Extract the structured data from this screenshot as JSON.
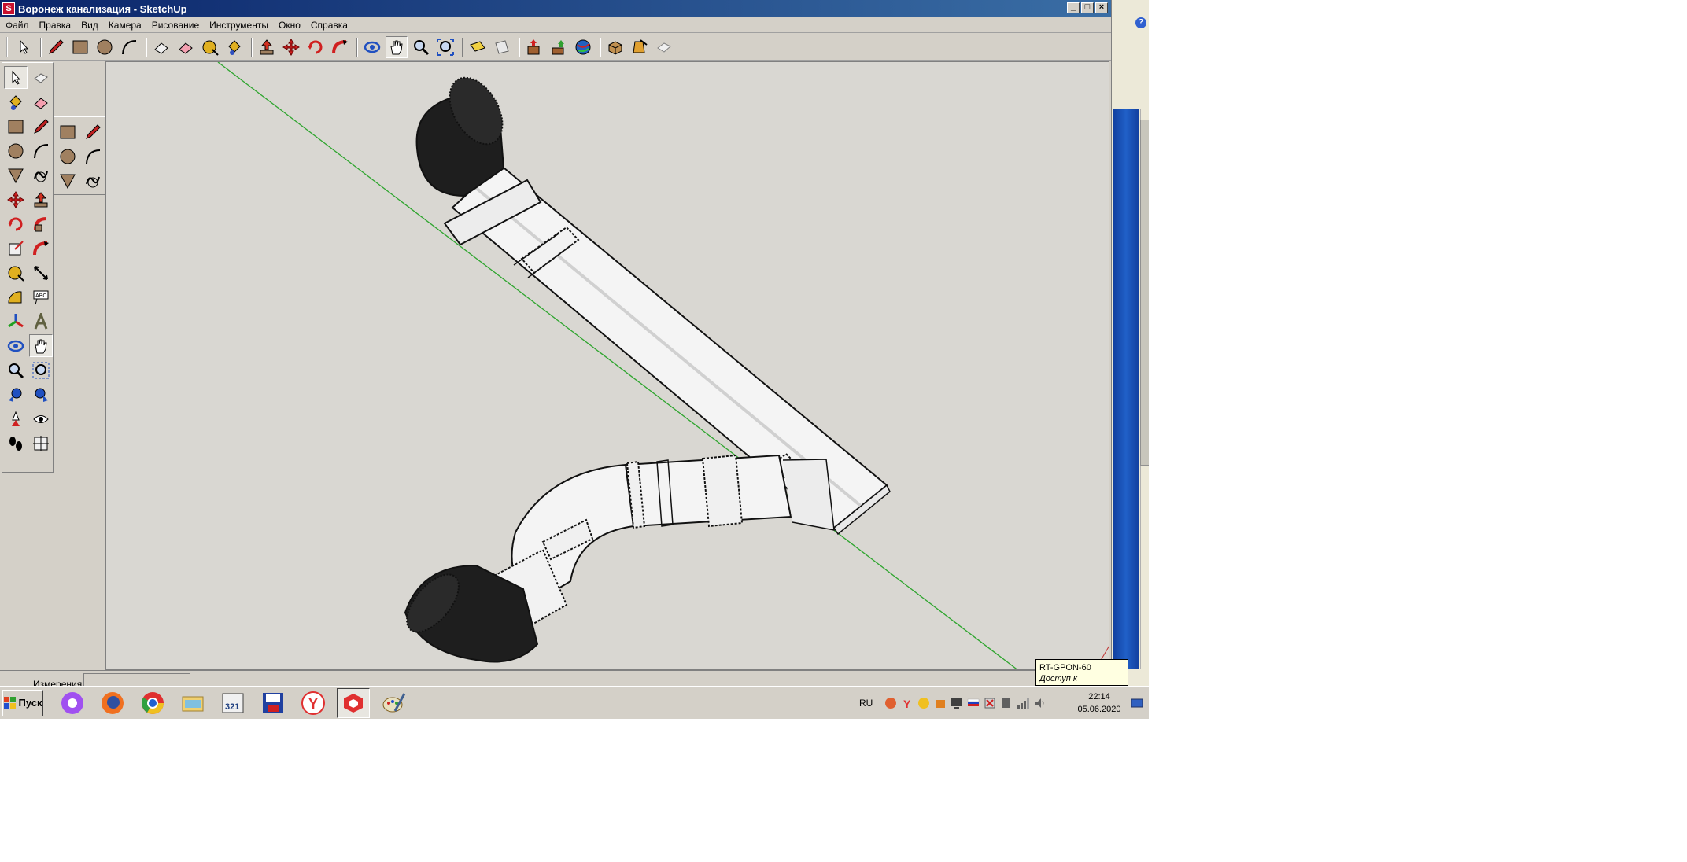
{
  "window": {
    "title": "Воронеж канализация - SketchUp",
    "controls": {
      "minimize": "_",
      "maximize": "□",
      "close": "×"
    }
  },
  "menu": [
    "Файл",
    "Правка",
    "Вид",
    "Камера",
    "Рисование",
    "Инструменты",
    "Окно",
    "Справка"
  ],
  "toolbar_icons": [
    "select-icon",
    "pencil-icon",
    "rectangle-icon",
    "circle-icon",
    "arc-icon",
    "eraser-icon",
    "paint-eraser-icon",
    "tape-measure-icon",
    "paint-bucket-icon",
    "push-pull-icon",
    "move-icon",
    "rotate-icon",
    "follow-me-icon",
    "orbit-icon",
    "pan-icon",
    "zoom-icon",
    "zoom-extents-icon",
    "section-plane-icon",
    "top-view-icon",
    "get-models-icon",
    "share-model-icon",
    "google-earth-icon",
    "components-icon",
    "materials-icon",
    "styles-icon"
  ],
  "status": {
    "measurements_label": "Измерения",
    "measurements_value": ""
  },
  "tooltip": {
    "network": "RT-GPON-60",
    "state": "Доступ к Интернету"
  },
  "taskbar": {
    "start_label": "Пуск",
    "apps": [
      "alice-icon",
      "firefox-icon",
      "chrome-icon",
      "explorer-icon",
      "media-player-icon",
      "save-icon",
      "yandex-browser-icon",
      "sketchup-icon",
      "paint-icon"
    ],
    "active_app": "sketchup-icon",
    "language": "RU",
    "time": "22:14",
    "date": "05.06.2020"
  },
  "colors": {
    "title_gradient_start": "#0a246a",
    "viewport_background": "#d9d7d2",
    "axis_green": "#2fa52f",
    "pipe_white": "#f4f4f4",
    "pipe_black": "#1e1e1e",
    "tooltip_bg": "#ffffe1"
  }
}
